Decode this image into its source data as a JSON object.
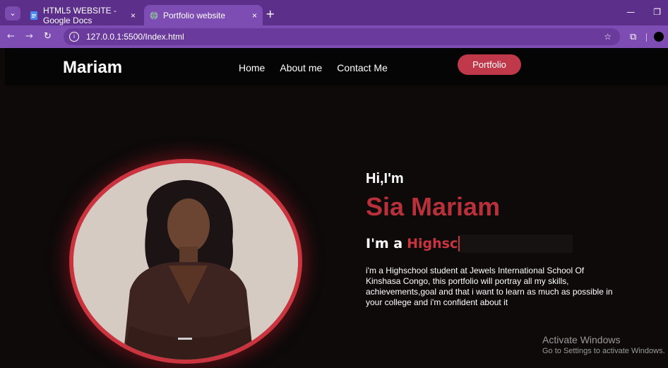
{
  "browser": {
    "tabs": [
      {
        "title": "HTML5 WEBSITE - Google Docs",
        "close": "×"
      },
      {
        "title": "Portfolio website",
        "close": "×"
      }
    ],
    "new_tab": "+",
    "window_controls": {
      "minimize": "—",
      "restore": "❐"
    },
    "url": "127.0.0.1:5500/Index.html",
    "icons": {
      "back": "arrow-left",
      "forward": "arrow-right",
      "reload": "reload",
      "star": "star",
      "extensions": "puzzle"
    }
  },
  "site": {
    "logo": "Mariam",
    "nav": [
      "Home",
      "About me",
      "Contact Me"
    ],
    "cta_label": "Portfolio",
    "hero": {
      "greeting": "Hi,I'm",
      "name": "Sia Mariam",
      "typing_prefix": "I'm a",
      "typing_text": "Highsc",
      "bio": "i'm a Highschool student at Jewels International School Of Kinshasa Congo, this portfolio will portray all my skills, achievements,goal and that i want to learn as much as possible in your college and i'm confident about it"
    }
  },
  "os_overlay": {
    "title": "Activate Windows",
    "subtitle": "Go to Settings to activate Windows."
  },
  "colors": {
    "accent": "#c9343e",
    "name_color": "#b8303a",
    "tab_bar": "#5c2f8a",
    "address_bar": "#7e4db3"
  }
}
